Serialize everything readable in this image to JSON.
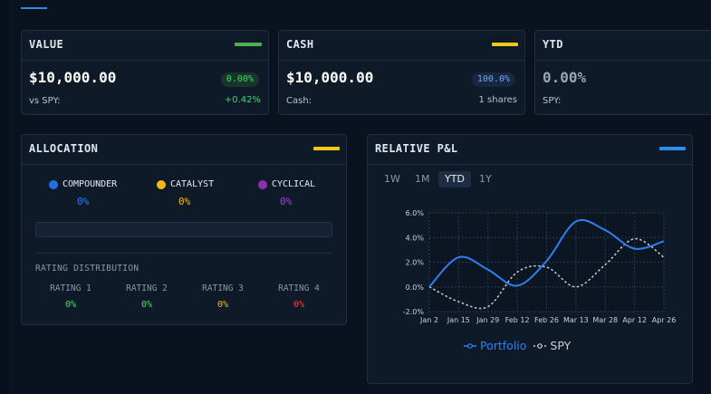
{
  "value_card": {
    "title": "VALUE",
    "amount": "$10,000.00",
    "pill": "0.00%",
    "sub_label": "vs SPY:",
    "sub_value": "+0.42%",
    "accent": "#4caf50"
  },
  "cash_card": {
    "title": "CASH",
    "amount": "$10,000.00",
    "pill": "100.0%",
    "sub_label": "Cash:",
    "sub_value": "1 shares",
    "accent": "#f5c518"
  },
  "ytd_card": {
    "title": "YTD",
    "amount": "0.00%",
    "sub_label": "SPY:"
  },
  "allocation": {
    "title": "ALLOCATION",
    "accent": "#f5c518",
    "categories": [
      {
        "label": "COMPOUNDER",
        "pct": "0%",
        "color": "#1f6fea"
      },
      {
        "label": "CATALYST",
        "pct": "0%",
        "color": "#f2b91e"
      },
      {
        "label": "CYCLICAL",
        "pct": "0%",
        "color": "#8e2fb0"
      }
    ],
    "distribution_title": "RATING DISTRIBUTION",
    "ratings": [
      {
        "label": "RATING 1",
        "pct": "0%",
        "color": "#3ddc68"
      },
      {
        "label": "RATING 2",
        "pct": "0%",
        "color": "#3ddc68"
      },
      {
        "label": "RATING 3",
        "pct": "0%",
        "color": "#f2b91e"
      },
      {
        "label": "RATING 4",
        "pct": "0%",
        "color": "#f04438"
      }
    ]
  },
  "pnl": {
    "title": "RELATIVE P&L",
    "accent": "#2f8ce8",
    "tabs": [
      "1W",
      "1M",
      "YTD",
      "1Y"
    ],
    "active_tab": "YTD",
    "legend": {
      "portfolio": "Portfolio",
      "spy": "SPY"
    }
  },
  "chart_data": {
    "type": "line",
    "x": [
      "Jan 2",
      "Jan 15",
      "Jan 29",
      "Feb 12",
      "Feb 26",
      "Mar 13",
      "Mar 28",
      "Apr 12",
      "Apr 26"
    ],
    "ylim": [
      -2.0,
      6.0
    ],
    "yticks": [
      "6.0%",
      "4.0%",
      "2.0%",
      "0.0%",
      "-2.0%"
    ],
    "grid": true,
    "legend_position": "bottom",
    "series": [
      {
        "name": "Portfolio",
        "color": "#2f7ff0",
        "dashed": false,
        "values": [
          0.0,
          2.4,
          1.4,
          0.1,
          2.1,
          5.3,
          4.6,
          3.1,
          3.7
        ]
      },
      {
        "name": "SPY",
        "color": "#c8cdd3",
        "dashed": true,
        "values": [
          0.0,
          -1.2,
          -1.6,
          1.2,
          1.6,
          0.0,
          1.8,
          3.9,
          2.4
        ]
      }
    ]
  }
}
